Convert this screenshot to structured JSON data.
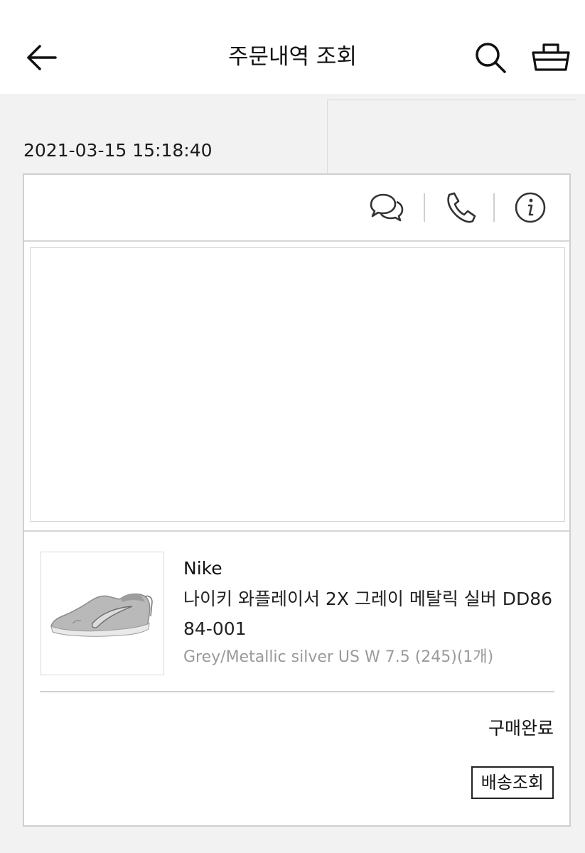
{
  "header": {
    "title": "주문내역 조회",
    "back_icon": "back-arrow-icon",
    "search_icon": "search-icon",
    "cart_icon": "cart-icon"
  },
  "order": {
    "date": "2021-03-15 15:18:40",
    "actions": [
      {
        "icon": "chat-icon"
      },
      {
        "icon": "phone-icon"
      },
      {
        "icon": "info-icon"
      }
    ],
    "item": {
      "brand": "Nike",
      "name": "나이키 와플레이서 2X 그레이 메탈릭 실버 DD8684-001",
      "option": "Grey/Metallic silver US W 7.5 (245)(1개)",
      "thumbnail_icon": "sneaker-image"
    },
    "status": "구매완료",
    "track_button": "배송조회"
  }
}
